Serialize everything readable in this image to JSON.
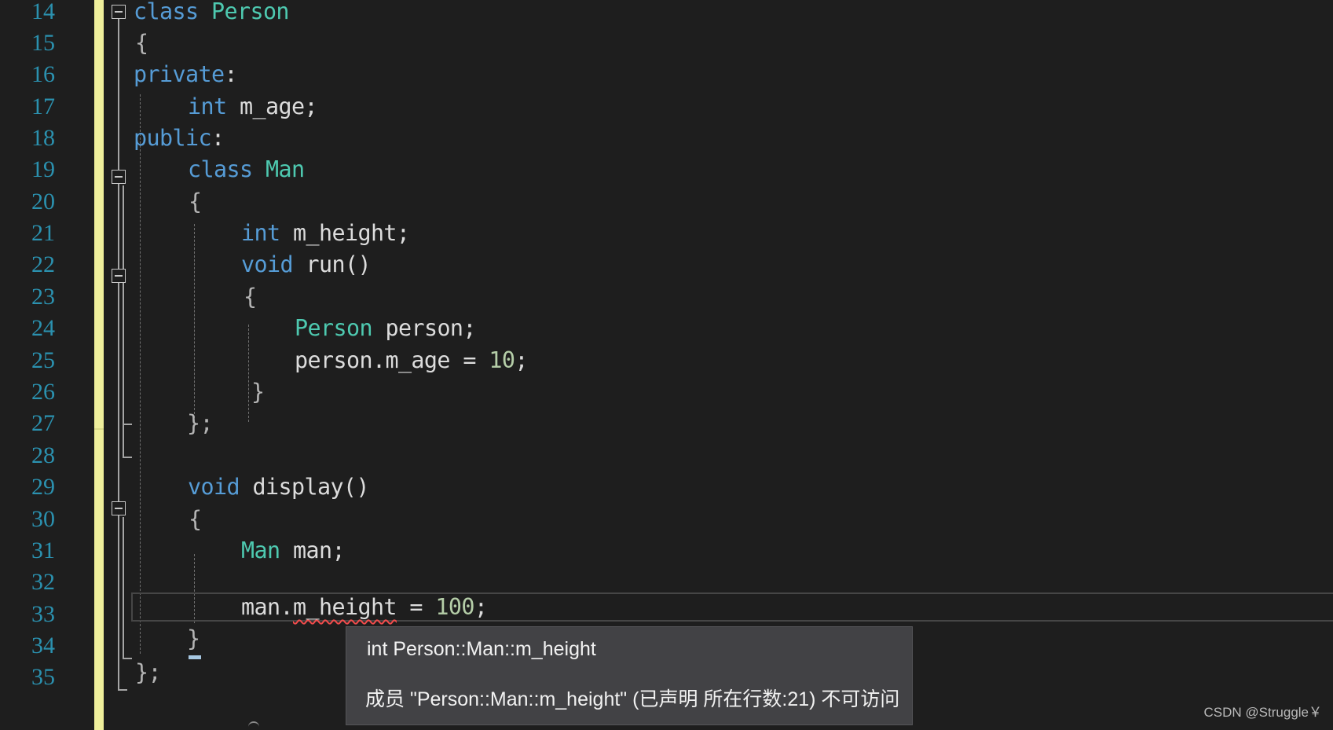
{
  "editor": {
    "line_numbers": [
      "14",
      "15",
      "16",
      "17",
      "18",
      "19",
      "20",
      "21",
      "22",
      "23",
      "24",
      "25",
      "26",
      "27",
      "28",
      "29",
      "30",
      "31",
      "32",
      "33",
      "34",
      "35"
    ],
    "lines": {
      "l14": {
        "t0": "class",
        "t1": "Person"
      },
      "l15": {
        "t0": "{"
      },
      "l16": {
        "t0": "private",
        "t1": ":"
      },
      "l17": {
        "t0": "int",
        "t1": "m_age;"
      },
      "l18": {
        "t0": "public",
        "t1": ":"
      },
      "l19": {
        "t0": "class",
        "t1": "Man"
      },
      "l20": {
        "t0": "{"
      },
      "l21": {
        "t0": "int",
        "t1": "m_height;"
      },
      "l22": {
        "t0": "void",
        "t1": "run()"
      },
      "l23": {
        "t0": "{"
      },
      "l24": {
        "t0": "Person",
        "t1": "person;"
      },
      "l25": {
        "t0": "person.m_age = ",
        "t1": "10",
        "t2": ";"
      },
      "l26": {
        "t0": "}"
      },
      "l27": {
        "t0": "};"
      },
      "l29": {
        "t0": "void",
        "t1": "display()"
      },
      "l30": {
        "t0": "{"
      },
      "l31": {
        "t0": "Man",
        "t1": "man;"
      },
      "l32": {
        "t0": "man.",
        "t1": "m_height",
        "t2": " = ",
        "t3": "100",
        "t4": ";"
      },
      "l33": {
        "t0": "}"
      },
      "l34": {
        "t0": "};"
      }
    }
  },
  "tooltip": {
    "signature": "int Person::Man::m_height",
    "message": "成员 \"Person::Man::m_height\" (已声明 所在行数:21) 不可访问"
  },
  "watermark": "CSDN @Struggle￥",
  "colors": {
    "background": "#1e1e1e",
    "line_number": "#2b91af",
    "keyword": "#569cd6",
    "type": "#4ec9b0",
    "number": "#b5cea8",
    "text": "#dcdcdc",
    "change_bar": "#efef9c",
    "tooltip_bg": "#424245",
    "error_squiggle": "#f14c4c"
  }
}
